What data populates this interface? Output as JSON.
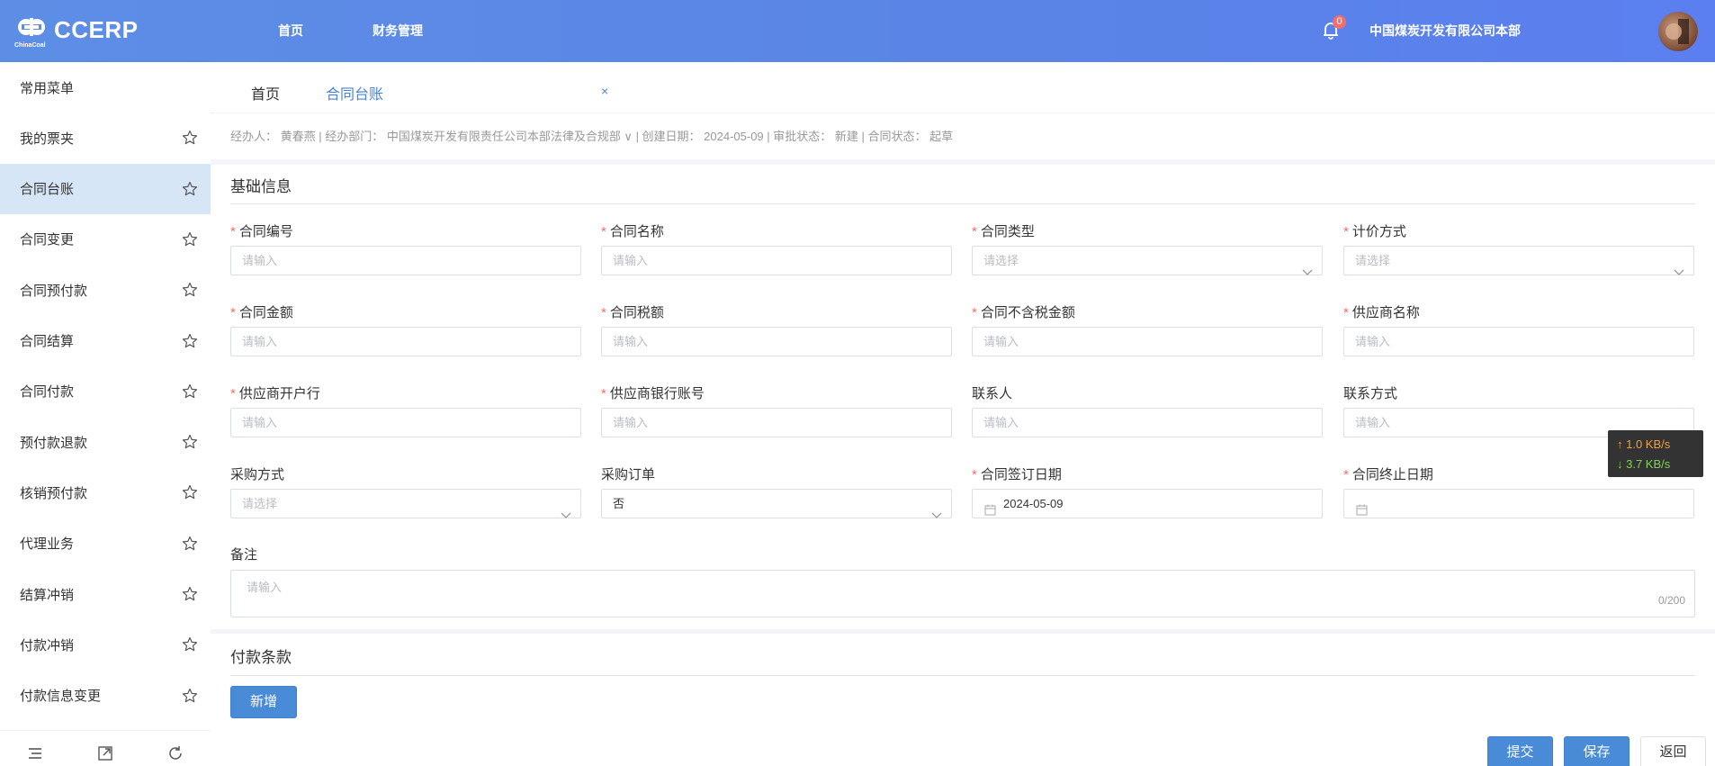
{
  "header": {
    "logo_text": "CCERP",
    "logo_sub": "ChinaCoal",
    "nav": [
      "首页",
      "财务管理"
    ],
    "notification_count": "0",
    "company": "中国煤炭开发有限公司本部"
  },
  "sidebar": {
    "items": [
      {
        "label": "常用菜单",
        "starred": false
      },
      {
        "label": "我的票夹",
        "starred": true
      },
      {
        "label": "合同台账",
        "starred": true,
        "active": true
      },
      {
        "label": "合同变更",
        "starred": true
      },
      {
        "label": "合同预付款",
        "starred": true
      },
      {
        "label": "合同结算",
        "starred": true
      },
      {
        "label": "合同付款",
        "starred": true
      },
      {
        "label": "预付款退款",
        "starred": true
      },
      {
        "label": "核销预付款",
        "starred": true
      },
      {
        "label": "代理业务",
        "starred": true
      },
      {
        "label": "结算冲销",
        "starred": true
      },
      {
        "label": "付款冲销",
        "starred": true
      },
      {
        "label": "付款信息变更",
        "starred": true
      }
    ]
  },
  "tabs": [
    {
      "label": "首页",
      "active": false
    },
    {
      "label": "合同台账",
      "active": true
    }
  ],
  "info_bar": {
    "text": "经办人：  黄春燕 | 经办部门：  中国煤炭开发有限责任公司本部法律及合规部 ∨ | 创建日期：  2024-05-09 | 审批状态：  新建 | 合同状态：  起草"
  },
  "sections": {
    "basic": "基础信息",
    "payment": "付款条款"
  },
  "fields": [
    {
      "label": "合同编号",
      "required": true,
      "placeholder": "请输入",
      "type": "input"
    },
    {
      "label": "合同名称",
      "required": true,
      "placeholder": "请输入",
      "type": "input"
    },
    {
      "label": "合同类型",
      "required": true,
      "placeholder": "请选择",
      "type": "select"
    },
    {
      "label": "计价方式",
      "required": true,
      "placeholder": "请选择",
      "type": "select"
    },
    {
      "label": "合同金额",
      "required": true,
      "placeholder": "请输入",
      "type": "input"
    },
    {
      "label": "合同税额",
      "required": true,
      "placeholder": "请输入",
      "type": "input"
    },
    {
      "label": "合同不含税金额",
      "required": true,
      "placeholder": "请输入",
      "type": "input"
    },
    {
      "label": "供应商名称",
      "required": true,
      "placeholder": "请输入",
      "type": "input"
    },
    {
      "label": "供应商开户行",
      "required": true,
      "placeholder": "请输入",
      "type": "input"
    },
    {
      "label": "供应商银行账号",
      "required": true,
      "placeholder": "请输入",
      "type": "input"
    },
    {
      "label": "联系人",
      "required": false,
      "placeholder": "请输入",
      "type": "input"
    },
    {
      "label": "联系方式",
      "required": false,
      "placeholder": "请输入",
      "type": "input"
    },
    {
      "label": "采购方式",
      "required": false,
      "placeholder": "请选择",
      "type": "select"
    },
    {
      "label": "采购订单",
      "required": false,
      "value": "否",
      "type": "select"
    },
    {
      "label": "合同签订日期",
      "required": true,
      "value": "2024-05-09",
      "type": "date"
    },
    {
      "label": "合同终止日期",
      "required": true,
      "value": "",
      "type": "date"
    }
  ],
  "remark": {
    "label": "备注",
    "placeholder": "请输入",
    "counter": "0/200"
  },
  "buttons": {
    "add": "新增",
    "submit": "提交",
    "save": "保存",
    "back": "返回"
  },
  "speed": {
    "up": "↑ 1.0 KB/s",
    "down": "↓ 3.7 KB/s"
  },
  "colors": {
    "header": "#5b86e8",
    "primary": "#4a8bd8",
    "required": "#f56c6c",
    "active_menu": "#d7e6f7"
  }
}
